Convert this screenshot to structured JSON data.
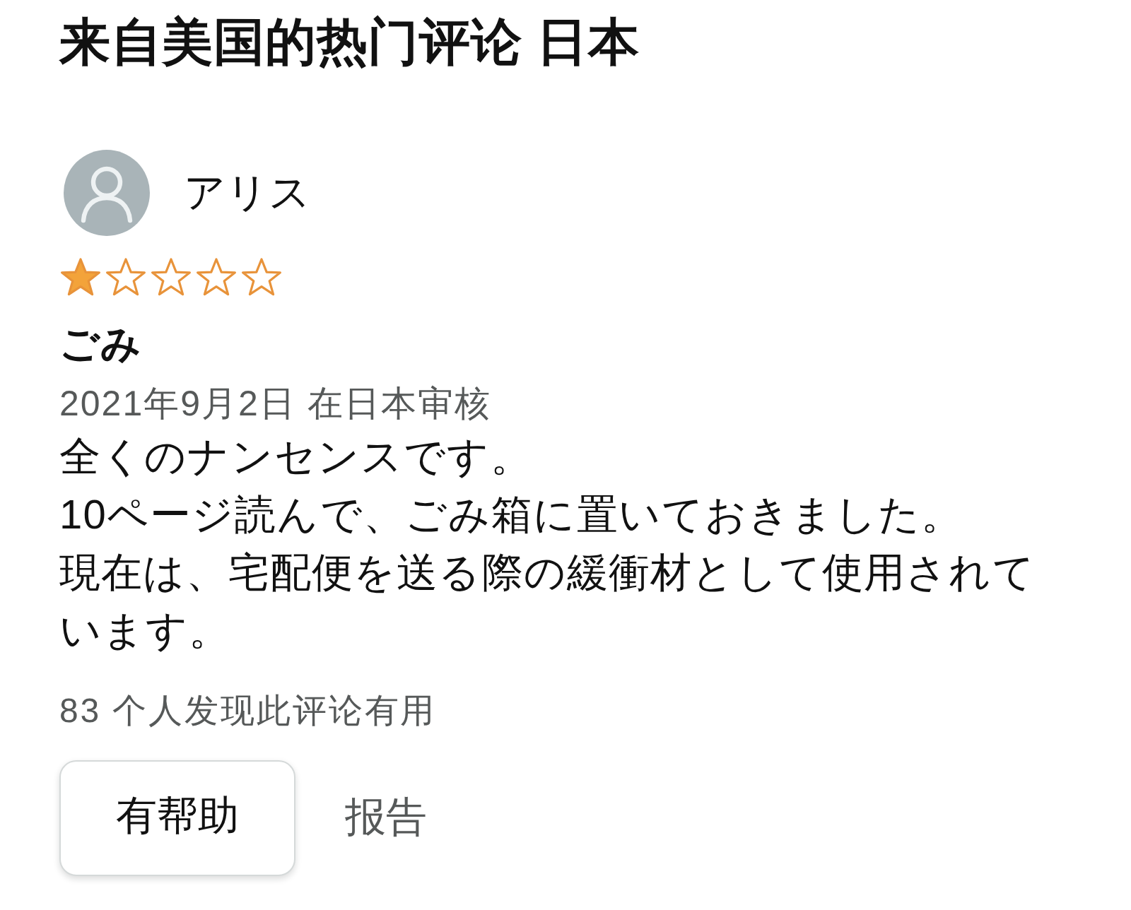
{
  "section_title": "来自美国的热门评论 日本",
  "review": {
    "reviewer": "アリス",
    "stars": 1,
    "title": "ごみ",
    "date_line": "2021年9月2日 在日本审核",
    "paragraphs": [
      "全くのナンセンスです。",
      "10ページ読んで、ごみ箱に置いておきました。",
      "現在は、宅配便を送る際の緩衝材として使用されています。"
    ],
    "helpful_count": "83 个人发现此评论有用",
    "actions": [
      {
        "kind": "button",
        "label": "有帮助"
      },
      {
        "kind": "link",
        "label": "报告"
      }
    ]
  }
}
